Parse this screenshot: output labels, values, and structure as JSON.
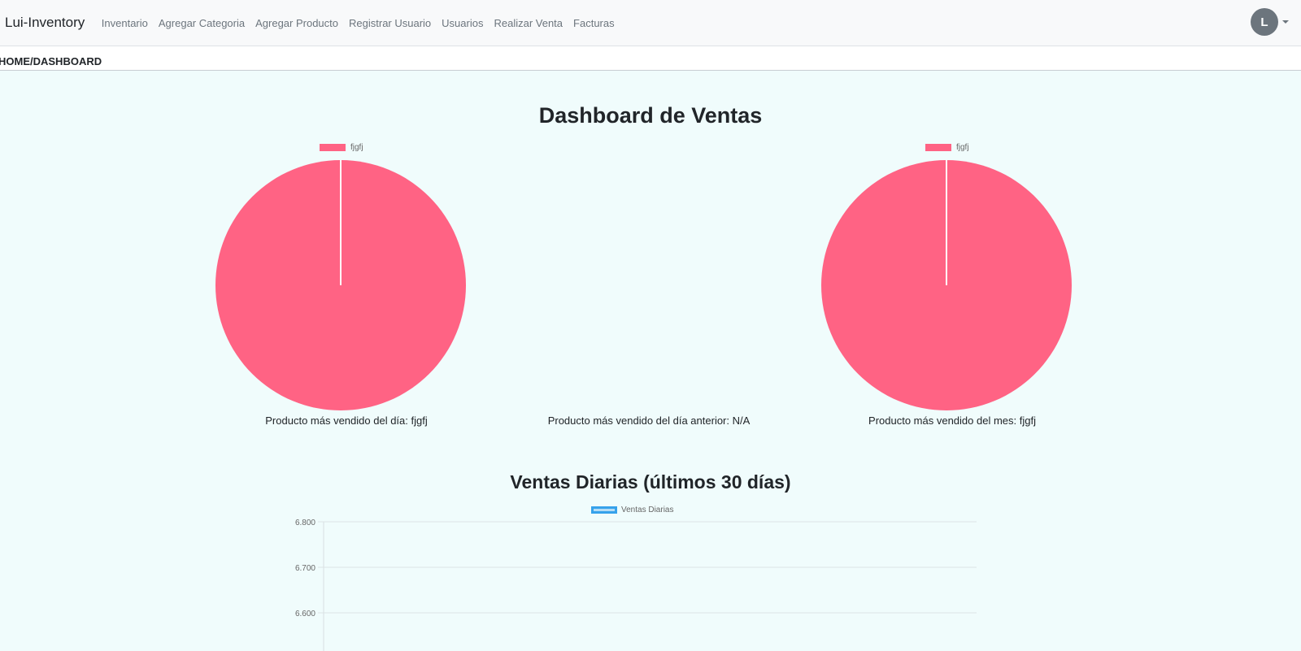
{
  "navbar": {
    "brand": "Lui-Inventory",
    "links": [
      "Inventario",
      "Agregar Categoria",
      "Agregar Producto",
      "Registrar Usuario",
      "Usuarios",
      "Realizar Venta",
      "Facturas"
    ],
    "avatar_initial": "L"
  },
  "breadcrumb": "HOME/DASHBOARD",
  "dashboard_title": "Dashboard de Ventas",
  "pies": [
    {
      "legend": "fjgfj",
      "caption": "Producto más vendido del día: fjgfj"
    },
    {
      "caption": "Producto más vendido del día anterior: N/A"
    },
    {
      "legend": "fjgfj",
      "caption": "Producto más vendido del mes: fjgfj"
    }
  ],
  "daily_title": "Ventas Diarias (últimos 30 días)",
  "colors": {
    "pie": "#ff6384",
    "line": "#36a2eb",
    "background": "#f0fcfc"
  },
  "chart_data": [
    {
      "type": "pie",
      "labels": [
        "fjgfj"
      ],
      "values": [
        1
      ]
    },
    {
      "type": "pie",
      "labels": [
        "fjgfj"
      ],
      "values": [
        1
      ]
    },
    {
      "type": "line",
      "series": [
        {
          "name": "Ventas Diarias",
          "values": []
        }
      ],
      "y_ticks": [
        "6.800",
        "6.700",
        "6.600"
      ],
      "ylim": [
        6.55,
        6.8
      ]
    }
  ]
}
